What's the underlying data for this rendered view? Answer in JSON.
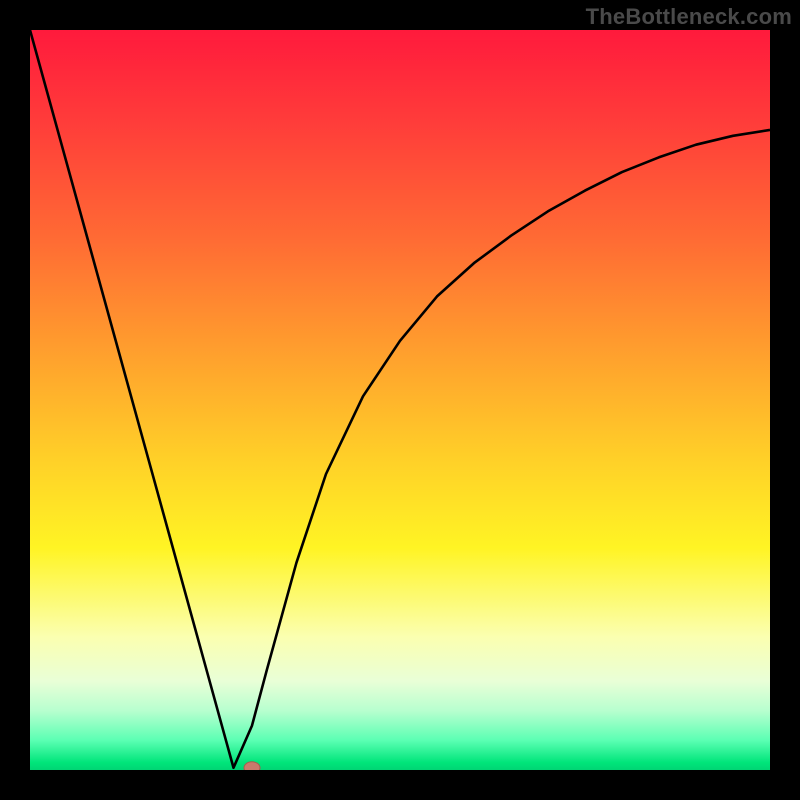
{
  "watermark": "TheBottleneck.com",
  "chart_data": {
    "type": "line",
    "title": "",
    "xlabel": "",
    "ylabel": "",
    "xlim": [
      0,
      1
    ],
    "ylim": [
      0,
      1
    ],
    "grid": false,
    "series": [
      {
        "name": "bottleneck-curve",
        "x": [
          0.0,
          0.04,
          0.08,
          0.12,
          0.16,
          0.2,
          0.24,
          0.275,
          0.3,
          0.32,
          0.36,
          0.4,
          0.45,
          0.5,
          0.55,
          0.6,
          0.65,
          0.7,
          0.75,
          0.8,
          0.85,
          0.9,
          0.95,
          1.0
        ],
        "values": [
          1.0,
          0.855,
          0.71,
          0.565,
          0.42,
          0.275,
          0.13,
          0.003,
          0.06,
          0.135,
          0.28,
          0.4,
          0.505,
          0.58,
          0.64,
          0.685,
          0.722,
          0.755,
          0.783,
          0.808,
          0.828,
          0.845,
          0.857,
          0.865
        ]
      }
    ],
    "marker": {
      "x": 0.3,
      "y": 0.003
    },
    "background_gradient": {
      "orientation": "vertical",
      "stops": [
        {
          "pos": 0.0,
          "color": "#ff1a3c"
        },
        {
          "pos": 0.28,
          "color": "#ff6a34"
        },
        {
          "pos": 0.58,
          "color": "#ffd028"
        },
        {
          "pos": 0.82,
          "color": "#fbffb0"
        },
        {
          "pos": 0.96,
          "color": "#5bffb3"
        },
        {
          "pos": 1.0,
          "color": "#00d574"
        }
      ]
    }
  }
}
